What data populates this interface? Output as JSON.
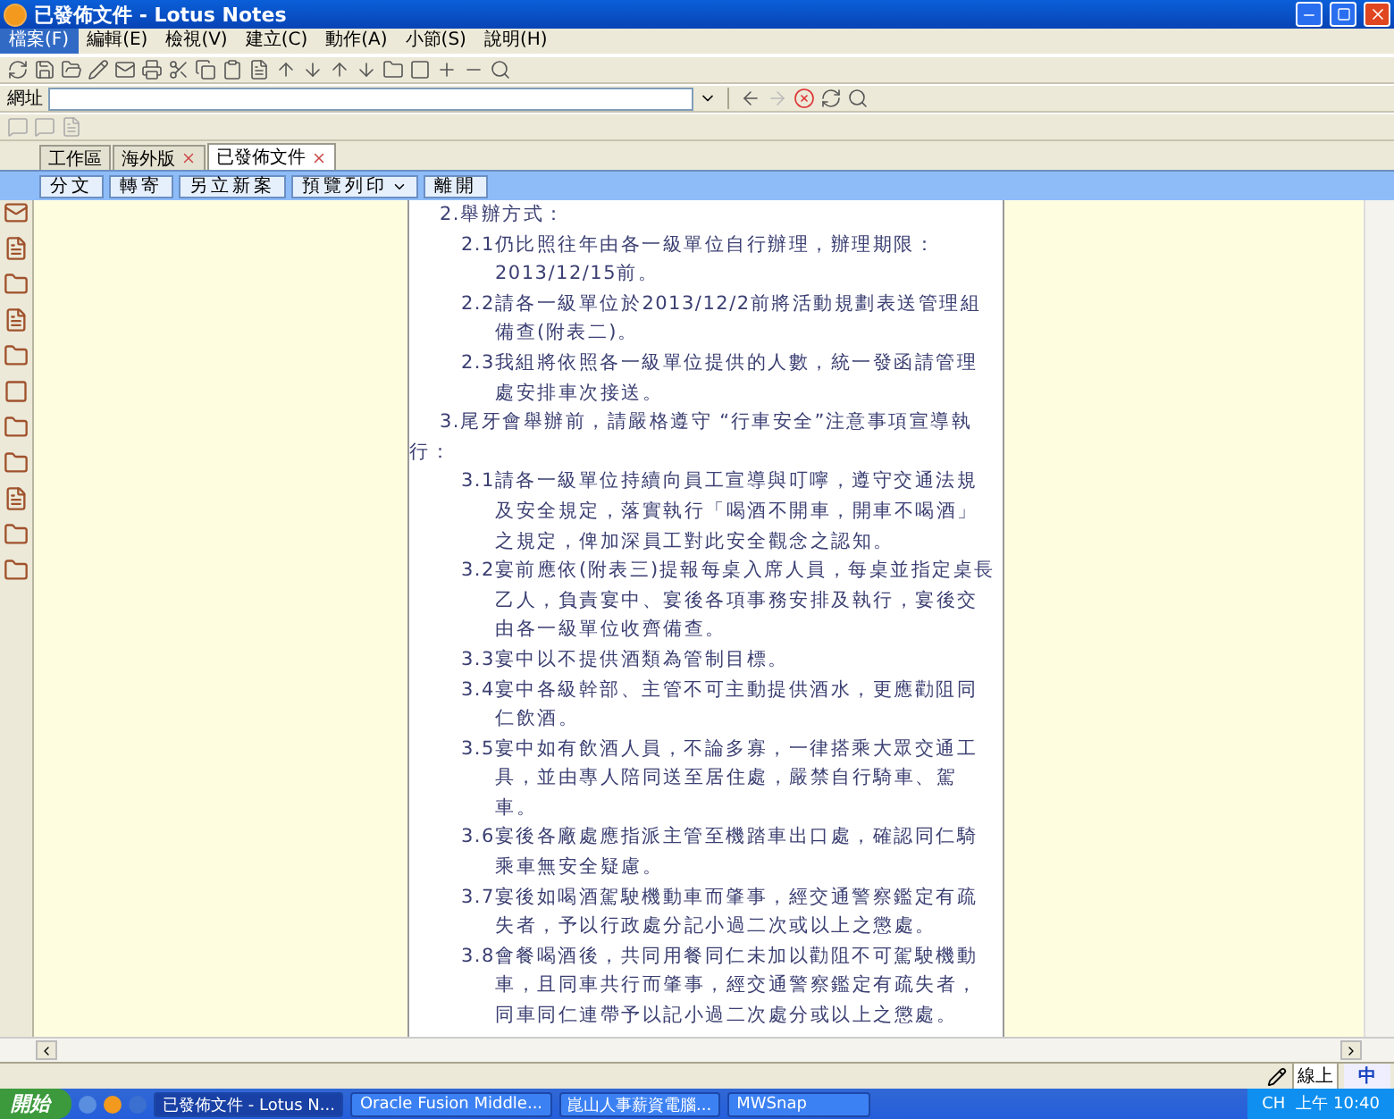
{
  "window": {
    "title": "已發佈文件 - Lotus Notes"
  },
  "menu": [
    {
      "label": "檔案(F)",
      "selected": true
    },
    {
      "label": "編輯(E)",
      "selected": false
    },
    {
      "label": "檢視(V)",
      "selected": false
    },
    {
      "label": "建立(C)",
      "selected": false
    },
    {
      "label": "動作(A)",
      "selected": false
    },
    {
      "label": "小節(S)",
      "selected": false
    },
    {
      "label": "說明(H)",
      "selected": false
    }
  ],
  "address": {
    "label": "網址"
  },
  "tabs": [
    {
      "label": "工作區",
      "closable": false,
      "selected": false
    },
    {
      "label": "海外版",
      "closable": true,
      "selected": false
    },
    {
      "label": "已發佈文件",
      "closable": true,
      "selected": true
    }
  ],
  "actions": [
    {
      "label": "分文",
      "dropdown": false
    },
    {
      "label": "轉寄",
      "dropdown": false
    },
    {
      "label": "另立新案",
      "dropdown": false
    },
    {
      "label": "預覽列印",
      "dropdown": true
    },
    {
      "label": "離開",
      "dropdown": false
    }
  ],
  "document": [
    {
      "kind": "heading",
      "text": "2.舉辦方式："
    },
    {
      "kind": "item",
      "text": "2.1仍比照往年由各一級單位自行辦理，辦理期限：2013/12/15前。"
    },
    {
      "kind": "item",
      "text": "2.2請各一級單位於2013/12/2前將活動規劃表送管理組備查(附表二)。"
    },
    {
      "kind": "item",
      "text": "2.3我組將依照各一級單位提供的人數，統一發函請管理處安排車次接送。"
    },
    {
      "kind": "heading",
      "text": "3.尾牙會舉辦前，請嚴格遵守 “行車安全”注意事項宣導執行："
    },
    {
      "kind": "item",
      "text": "3.1請各一級單位持續向員工宣導與叮嚀，遵守交通法規及安全規定，落實執行「喝酒不開車，開車不喝酒」之規定，俾加深員工對此安全觀念之認知。"
    },
    {
      "kind": "item",
      "text": "3.2宴前應依(附表三)提報每桌入席人員，每桌並指定桌長乙人，負責宴中、宴後各項事務安排及執行，宴後交由各一級單位收齊備查。"
    },
    {
      "kind": "item",
      "text": "3.3宴中以不提供酒類為管制目標。"
    },
    {
      "kind": "item",
      "text": "3.4宴中各級幹部、主管不可主動提供酒水，更應勸阻同仁飲酒。"
    },
    {
      "kind": "item",
      "text": "3.5宴中如有飲酒人員，不論多寡，一律搭乘大眾交通工具，並由專人陪同送至居住處，嚴禁自行騎車、駕車。"
    },
    {
      "kind": "item",
      "text": "3.6宴後各廠處應指派主管至機踏車出口處，確認同仁騎乘車無安全疑慮。"
    },
    {
      "kind": "item",
      "text": "3.7宴後如喝酒駕駛機動車而肇事，經交通警察鑑定有疏失者，予以行政處分記小過二次或以上之懲處。"
    },
    {
      "kind": "item",
      "text": "3.8會餐喝酒後，共同用餐同仁未加以勸阻不可駕駛機動車，且同車共行而肇事，經交通警察鑑定有疏失者，同車同仁連帶予以記小過二次處分或以上之懲處。"
    }
  ],
  "status_bar": {
    "status": "線上",
    "ime": "中"
  },
  "taskbar": {
    "start": "開始",
    "tasks": [
      {
        "label": "已發佈文件 - Lotus N...",
        "selected": true
      },
      {
        "label": "Oracle Fusion Middle...",
        "selected": false
      },
      {
        "label": "崑山人事薪資電腦...",
        "selected": false
      },
      {
        "label": "MWSnap",
        "selected": false
      }
    ],
    "lang": "CH",
    "clock": "上午 10:40"
  }
}
